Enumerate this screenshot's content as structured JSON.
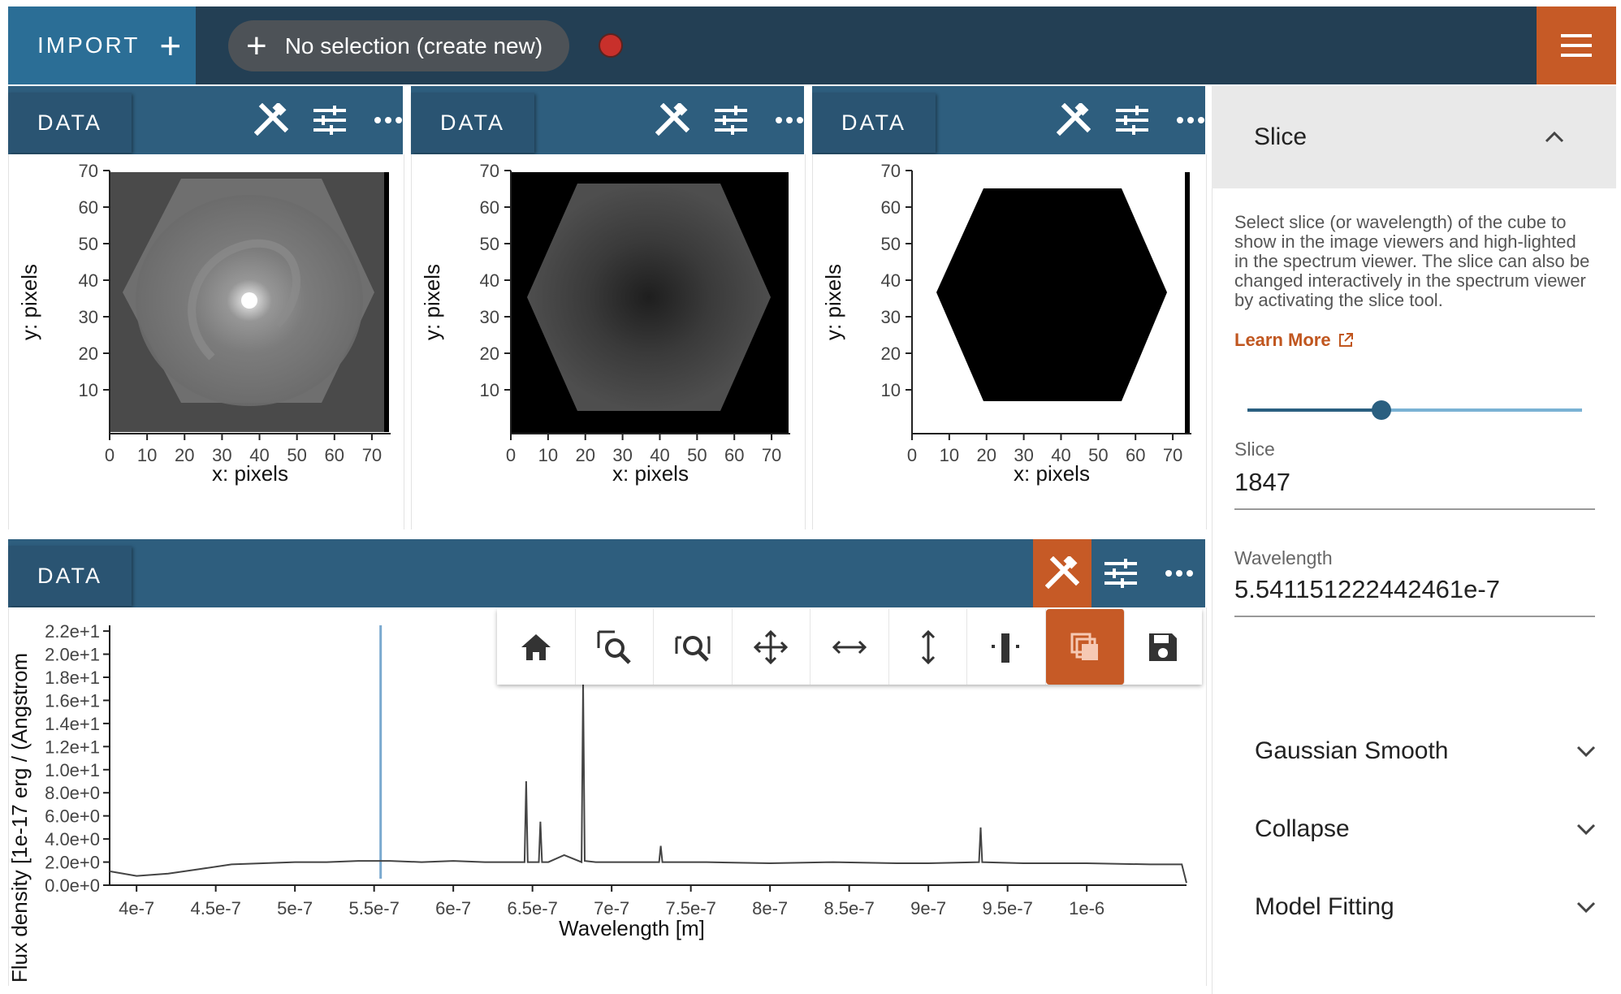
{
  "topbar": {
    "import_label": "IMPORT",
    "selection_label": "No selection (create new)"
  },
  "viewers": [
    {
      "tab": "DATA"
    },
    {
      "tab": "DATA"
    },
    {
      "tab": "DATA"
    }
  ],
  "image_axes": {
    "y_ticks": [
      "70",
      "60",
      "50",
      "40",
      "30",
      "20",
      "10"
    ],
    "x_ticks": [
      "0",
      "10",
      "20",
      "30",
      "40",
      "50",
      "60",
      "70"
    ],
    "xlabel": "x: pixels",
    "ylabel": "y: pixels"
  },
  "spectrum_viewer": {
    "tab": "DATA",
    "ylabel": "Flux density [1e-17 erg / (Angstrom",
    "xlabel": "Wavelength [m]",
    "y_ticks": [
      "2.2e+1",
      "2.0e+1",
      "1.8e+1",
      "1.6e+1",
      "1.4e+1",
      "1.2e+1",
      "1.0e+1",
      "8.0e+0",
      "6.0e+0",
      "4.0e+0",
      "2.0e+0",
      "0.0e+0"
    ],
    "x_ticks": [
      "4e-7",
      "4.5e-7",
      "5e-7",
      "5.5e-7",
      "6e-7",
      "6.5e-7",
      "7e-7",
      "7.5e-7",
      "8e-7",
      "8.5e-7",
      "9e-7",
      "9.5e-7",
      "1e-6"
    ]
  },
  "chart_data": {
    "type": "line",
    "xlabel": "Wavelength [m]",
    "ylabel": "Flux density [1e-17 erg / (Angstrom",
    "xlim": [
      3.83e-07,
      1.063e-06
    ],
    "ylim": [
      0,
      22.5
    ],
    "slice_indicator_x": 5.5412e-07,
    "series": [
      {
        "x": [
          3.83e-07,
          4e-07,
          4.2e-07,
          4.4e-07,
          4.6e-07,
          4.8e-07,
          5e-07,
          5.2e-07,
          5.4e-07,
          5.6e-07,
          5.8e-07,
          6e-07,
          6.2e-07,
          6.4e-07,
          6.45e-07,
          6.46e-07,
          6.47e-07,
          6.5e-07,
          6.54e-07,
          6.55e-07,
          6.56e-07,
          6.6e-07,
          6.7e-07,
          6.81e-07,
          6.82e-07,
          6.83e-07,
          6.9e-07,
          7.2e-07,
          7.3e-07,
          7.31e-07,
          7.32e-07,
          7.6e-07,
          8e-07,
          8.4e-07,
          8.8e-07,
          9e-07,
          9.32e-07,
          9.33e-07,
          9.34e-07,
          9.6e-07,
          1e-06,
          1.04e-06,
          1.06e-06,
          1.063e-06
        ],
        "y": [
          1.2,
          0.8,
          1.0,
          1.4,
          1.8,
          1.9,
          2.0,
          2.0,
          2.1,
          2.1,
          2.0,
          2.1,
          2.0,
          2.0,
          2.0,
          9.0,
          2.0,
          2.0,
          2.0,
          5.5,
          2.0,
          2.0,
          2.6,
          2.0,
          17.5,
          2.1,
          2.0,
          2.0,
          2.0,
          3.4,
          2.0,
          2.0,
          1.9,
          2.0,
          1.9,
          1.9,
          2.0,
          5.0,
          2.0,
          1.9,
          1.9,
          1.8,
          1.8,
          0.2
        ]
      }
    ]
  },
  "sidepanel": {
    "slice_title": "Slice",
    "description": "Select slice (or wavelength) of the cube to show in the image viewers and high-lighted in the spectrum viewer. The slice can also be changed interactively in the spectrum viewer by activating the slice tool.",
    "learn_more": "Learn More",
    "slider_fraction": 0.4,
    "slice_label": "Slice",
    "slice_value": "1847",
    "wavelength_label": "Wavelength",
    "wavelength_value": "5.541151222442461e-7",
    "plugins": [
      "Gaussian Smooth",
      "Collapse",
      "Model Fitting"
    ]
  },
  "colors": {
    "topbar": "#233f54",
    "import": "#2b6e96",
    "viewer_header": "#2e5e7e",
    "accent_orange": "#c65a26",
    "slice_line": "#7aa9cf"
  }
}
